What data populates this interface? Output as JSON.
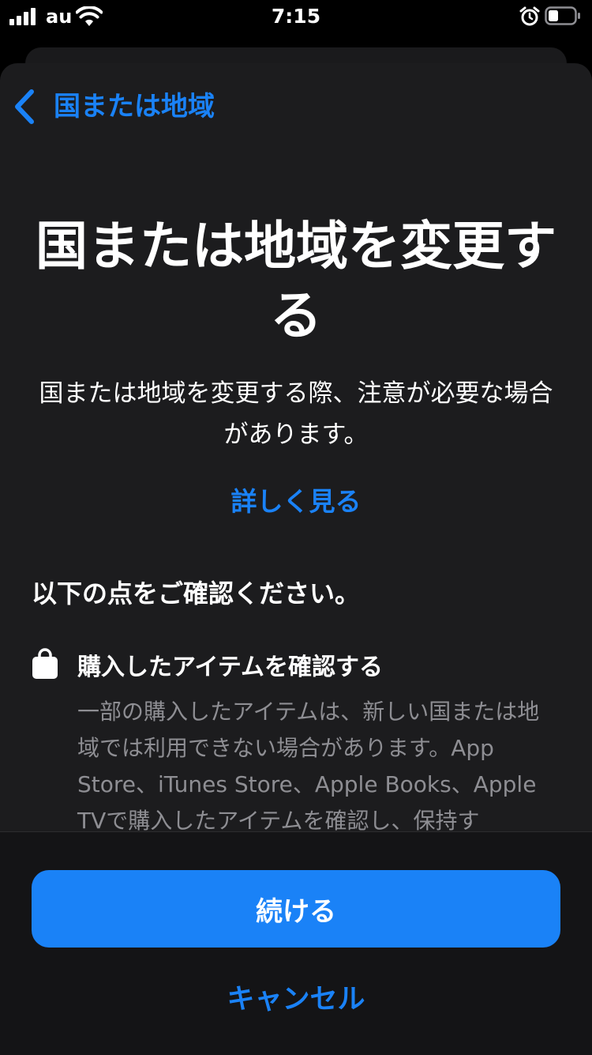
{
  "status_bar": {
    "carrier": "au",
    "time": "7:15",
    "icons": [
      "cellular-signal-icon",
      "wifi-icon",
      "alarm-icon",
      "battery-icon"
    ]
  },
  "nav": {
    "back_label": "国または地域",
    "back_icon": "chevron-left-icon"
  },
  "main": {
    "headline": "国または地域を変更する",
    "subtitle": "国または地域を変更する際、注意が必要な場合があります。",
    "learn_more": "詳しく見る",
    "section_heading": "以下の点をご確認ください。",
    "items": [
      {
        "icon": "shopping-bag-icon",
        "title": "購入したアイテムを確認する",
        "description": "一部の購入したアイテムは、新しい国または地域では利用できない場合があります。App Store、iTunes Store、Apple Books、Apple TVで購入したアイテムを確認し、保持す"
      }
    ]
  },
  "actions": {
    "continue_label": "続ける",
    "cancel_label": "キャンセル"
  },
  "colors": {
    "accent": "#1a82f7",
    "sheet_background": "#1c1c1e",
    "secondary_text": "#8e8e93"
  }
}
